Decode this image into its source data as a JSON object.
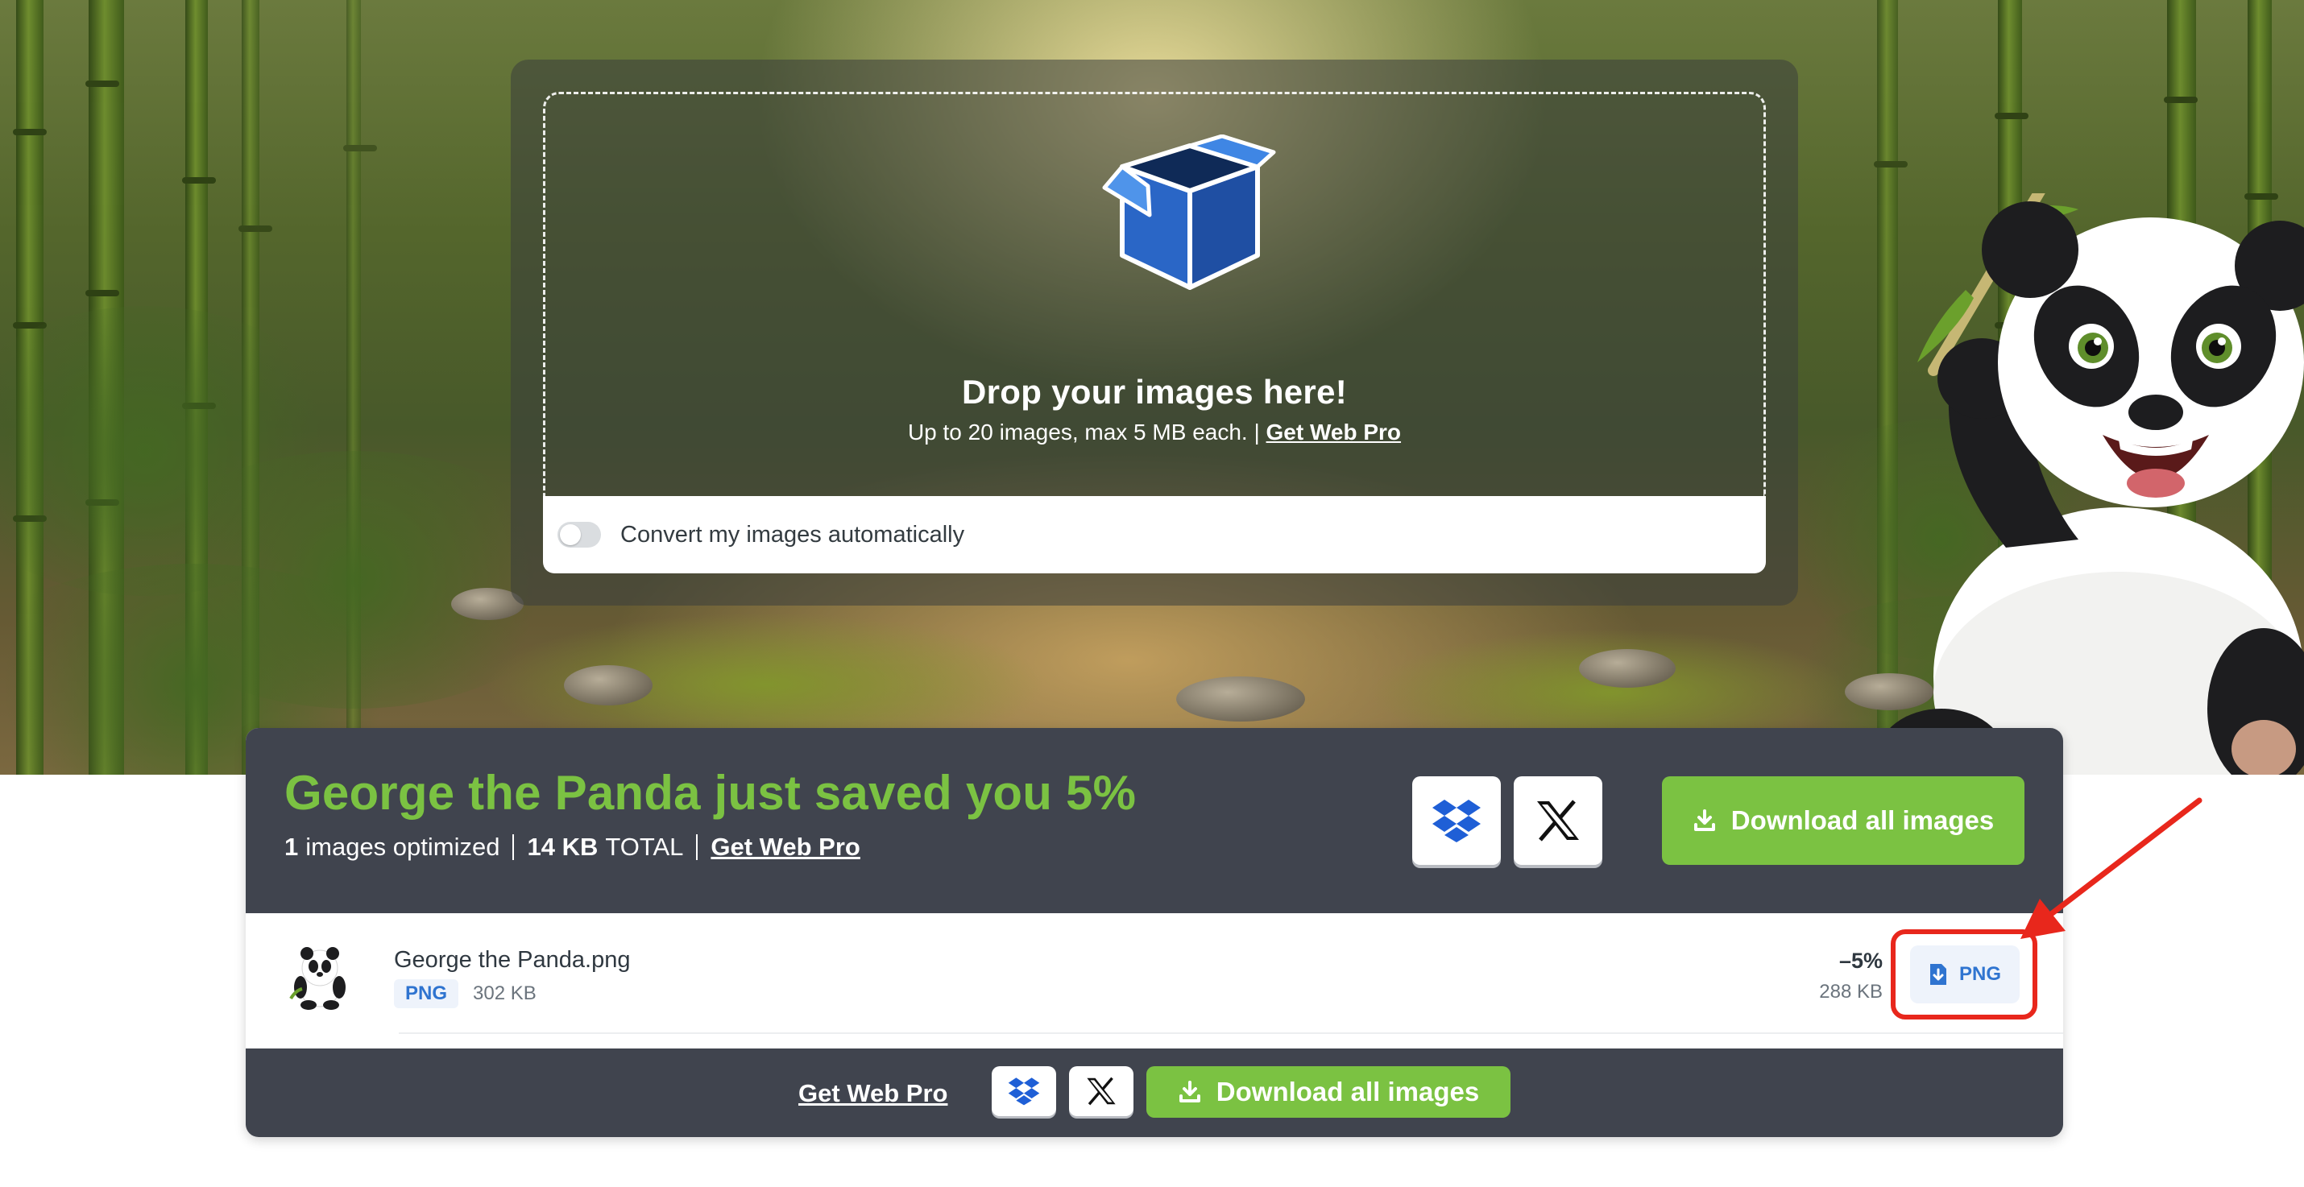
{
  "upload": {
    "title": "Drop your images here!",
    "subtitle": "Up to 20 images, max 5 MB each.",
    "subtitle_link": "Get Web Pro",
    "convert_label": "Convert my images automatically",
    "convert_enabled": false,
    "icon": "open-box-icon"
  },
  "results": {
    "headline": "George the Panda just saved you 5%",
    "images_count": "1",
    "images_label": "images optimized",
    "total_size": "14 KB",
    "total_label": "TOTAL",
    "pro_link": "Get Web Pro",
    "download_all": "Download all images",
    "share_icons": [
      "dropbox-icon",
      "x-icon"
    ]
  },
  "file": {
    "name": "George the Panda.png",
    "type": "PNG",
    "original_size": "302 KB",
    "reduction": "–5%",
    "new_size": "288 KB",
    "download_label": "PNG"
  },
  "footer": {
    "pro_link": "Get Web Pro",
    "download_all": "Download all images"
  },
  "colors": {
    "accent_green": "#7bc242",
    "panel_dark": "#40444e",
    "link_blue": "#2f74d0",
    "annotation_red": "#e8271c"
  }
}
